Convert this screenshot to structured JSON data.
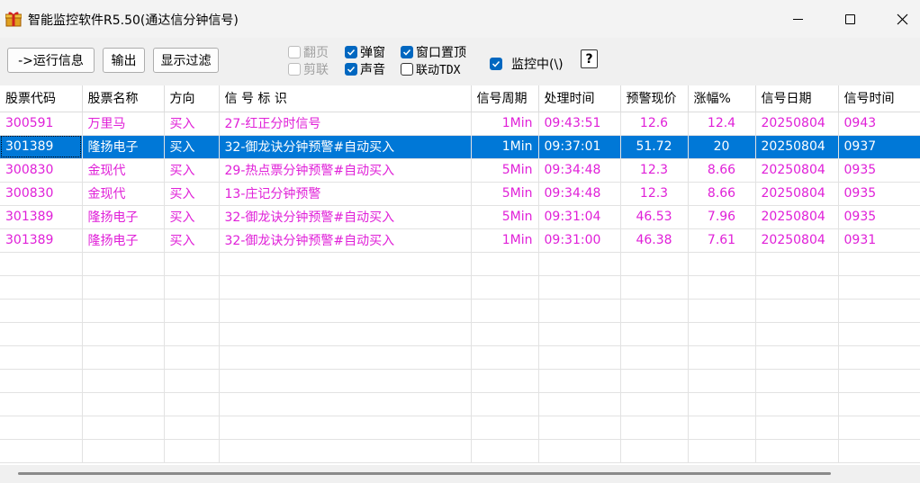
{
  "window": {
    "title": "智能监控软件R5.50(通达信分钟信号)"
  },
  "toolbar": {
    "run_info": "->运行信息",
    "output": "输出",
    "filter": "显示过滤",
    "checkboxes": {
      "fanye": {
        "label": "翻页",
        "checked": false,
        "enabled": false
      },
      "jianlian": {
        "label": "剪联",
        "checked": false,
        "enabled": false
      },
      "popup": {
        "label": "弹窗",
        "checked": true,
        "enabled": true
      },
      "sound": {
        "label": "声音",
        "checked": true,
        "enabled": true
      },
      "topmost": {
        "label": "窗口置顶",
        "checked": true,
        "enabled": true
      },
      "link_tdx": {
        "label": "联动TDX",
        "checked": false,
        "enabled": true
      },
      "monitoring": {
        "label": "监控中(\\)",
        "checked": true,
        "enabled": true
      }
    },
    "help": "?"
  },
  "table": {
    "headers": [
      "股票代码",
      "股票名称",
      "方向",
      "信 号 标 识",
      "信号周期",
      "处理时间",
      "预警现价",
      "涨幅%",
      "信号日期",
      "信号时间"
    ],
    "rows": [
      [
        "300591",
        "万里马",
        "买入",
        "27-红正分时信号",
        "1Min",
        "09:43:51",
        "12.6",
        "12.4",
        "20250804",
        "0943"
      ],
      [
        "301389",
        "隆扬电子",
        "买入",
        "32-御龙诀分钟预警#自动买入",
        "1Min",
        "09:37:01",
        "51.72",
        "20",
        "20250804",
        "0937"
      ],
      [
        "300830",
        "金现代",
        "买入",
        "29-热点票分钟预警#自动买入",
        "5Min",
        "09:34:48",
        "12.3",
        "8.66",
        "20250804",
        "0935"
      ],
      [
        "300830",
        "金现代",
        "买入",
        "13-庄记分钟预警",
        "5Min",
        "09:34:48",
        "12.3",
        "8.66",
        "20250804",
        "0935"
      ],
      [
        "301389",
        "隆扬电子",
        "买入",
        "32-御龙诀分钟预警#自动买入",
        "5Min",
        "09:31:04",
        "46.53",
        "7.96",
        "20250804",
        "0935"
      ],
      [
        "301389",
        "隆扬电子",
        "买入",
        "32-御龙诀分钟预警#自动买入",
        "1Min",
        "09:31:00",
        "46.38",
        "7.61",
        "20250804",
        "0931"
      ]
    ],
    "selected_row": 1
  },
  "colors": {
    "row_text": "#e020d8",
    "selection": "#0078d7",
    "checkbox": "#0067c0"
  }
}
